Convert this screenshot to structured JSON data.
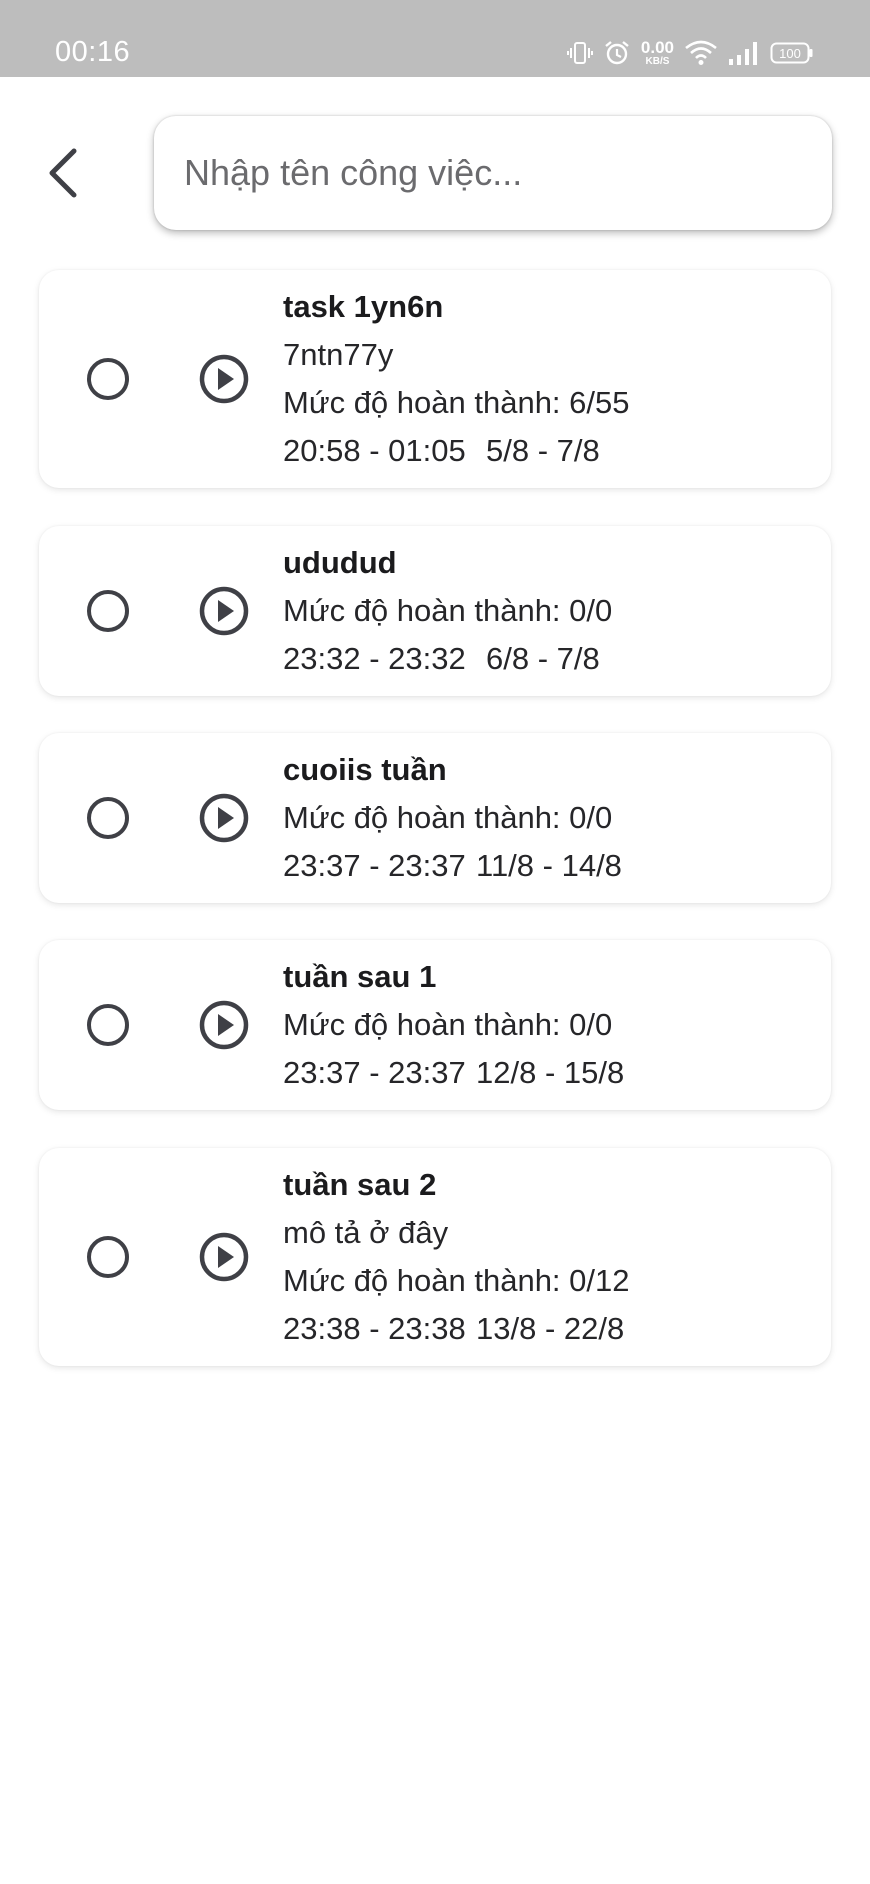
{
  "status_bar": {
    "time": "00:16",
    "net_speed_value": "0.00",
    "net_speed_unit": "KB/S",
    "battery": "100",
    "icons": [
      "vibrate-icon",
      "alarm-icon",
      "wifi-icon",
      "signal-icon",
      "battery-icon"
    ]
  },
  "header": {
    "back_icon": "chevron-left-icon",
    "search": {
      "placeholder": "Nhập tên công việc...",
      "value": ""
    }
  },
  "tasks": [
    {
      "title": "task 1yn6n",
      "description": "7ntn77y",
      "progress": "Mức độ hoàn thành: 6/55",
      "time_range": "20:58 - 01:05",
      "date_range": "5/8 - 7/8"
    },
    {
      "title": "ududud",
      "progress": "Mức độ hoàn thành: 0/0",
      "time_range": "23:32 - 23:32",
      "date_range": "6/8 - 7/8"
    },
    {
      "title": "cuoiis tuần",
      "progress": "Mức độ hoàn thành: 0/0",
      "time_range": "23:37 - 23:37",
      "date_range": "11/8 - 14/8"
    },
    {
      "title": "tuần sau 1",
      "progress": "Mức độ hoàn thành: 0/0",
      "time_range": "23:37 - 23:37",
      "date_range": "12/8 - 15/8"
    },
    {
      "title": "tuần sau 2",
      "description": "mô tả ở đây",
      "progress": "Mức độ hoàn thành: 0/12",
      "time_range": "23:38 - 23:38",
      "date_range": "13/8 - 22/8"
    }
  ],
  "colors": {
    "status_bar_bg": "#bdbdbd",
    "icon_dark": "#3f4046",
    "text_dark": "#262629"
  }
}
